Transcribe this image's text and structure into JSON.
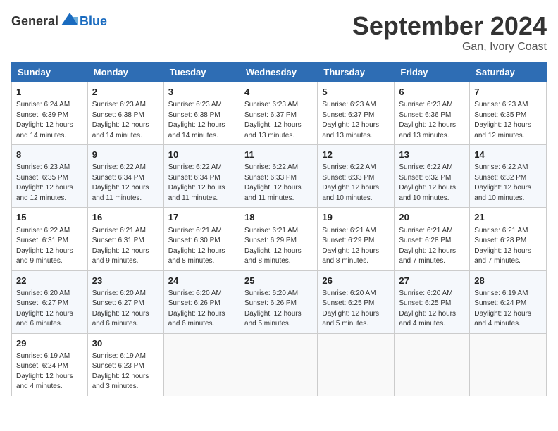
{
  "logo": {
    "text_general": "General",
    "text_blue": "Blue"
  },
  "title": "September 2024",
  "location": "Gan, Ivory Coast",
  "days_of_week": [
    "Sunday",
    "Monday",
    "Tuesday",
    "Wednesday",
    "Thursday",
    "Friday",
    "Saturday"
  ],
  "weeks": [
    [
      {
        "day": "1",
        "sunrise": "6:24 AM",
        "sunset": "6:39 PM",
        "daylight": "12 hours and 14 minutes."
      },
      {
        "day": "2",
        "sunrise": "6:23 AM",
        "sunset": "6:38 PM",
        "daylight": "12 hours and 14 minutes."
      },
      {
        "day": "3",
        "sunrise": "6:23 AM",
        "sunset": "6:38 PM",
        "daylight": "12 hours and 14 minutes."
      },
      {
        "day": "4",
        "sunrise": "6:23 AM",
        "sunset": "6:37 PM",
        "daylight": "12 hours and 13 minutes."
      },
      {
        "day": "5",
        "sunrise": "6:23 AM",
        "sunset": "6:37 PM",
        "daylight": "12 hours and 13 minutes."
      },
      {
        "day": "6",
        "sunrise": "6:23 AM",
        "sunset": "6:36 PM",
        "daylight": "12 hours and 13 minutes."
      },
      {
        "day": "7",
        "sunrise": "6:23 AM",
        "sunset": "6:35 PM",
        "daylight": "12 hours and 12 minutes."
      }
    ],
    [
      {
        "day": "8",
        "sunrise": "6:23 AM",
        "sunset": "6:35 PM",
        "daylight": "12 hours and 12 minutes."
      },
      {
        "day": "9",
        "sunrise": "6:22 AM",
        "sunset": "6:34 PM",
        "daylight": "12 hours and 11 minutes."
      },
      {
        "day": "10",
        "sunrise": "6:22 AM",
        "sunset": "6:34 PM",
        "daylight": "12 hours and 11 minutes."
      },
      {
        "day": "11",
        "sunrise": "6:22 AM",
        "sunset": "6:33 PM",
        "daylight": "12 hours and 11 minutes."
      },
      {
        "day": "12",
        "sunrise": "6:22 AM",
        "sunset": "6:33 PM",
        "daylight": "12 hours and 10 minutes."
      },
      {
        "day": "13",
        "sunrise": "6:22 AM",
        "sunset": "6:32 PM",
        "daylight": "12 hours and 10 minutes."
      },
      {
        "day": "14",
        "sunrise": "6:22 AM",
        "sunset": "6:32 PM",
        "daylight": "12 hours and 10 minutes."
      }
    ],
    [
      {
        "day": "15",
        "sunrise": "6:22 AM",
        "sunset": "6:31 PM",
        "daylight": "12 hours and 9 minutes."
      },
      {
        "day": "16",
        "sunrise": "6:21 AM",
        "sunset": "6:31 PM",
        "daylight": "12 hours and 9 minutes."
      },
      {
        "day": "17",
        "sunrise": "6:21 AM",
        "sunset": "6:30 PM",
        "daylight": "12 hours and 8 minutes."
      },
      {
        "day": "18",
        "sunrise": "6:21 AM",
        "sunset": "6:29 PM",
        "daylight": "12 hours and 8 minutes."
      },
      {
        "day": "19",
        "sunrise": "6:21 AM",
        "sunset": "6:29 PM",
        "daylight": "12 hours and 8 minutes."
      },
      {
        "day": "20",
        "sunrise": "6:21 AM",
        "sunset": "6:28 PM",
        "daylight": "12 hours and 7 minutes."
      },
      {
        "day": "21",
        "sunrise": "6:21 AM",
        "sunset": "6:28 PM",
        "daylight": "12 hours and 7 minutes."
      }
    ],
    [
      {
        "day": "22",
        "sunrise": "6:20 AM",
        "sunset": "6:27 PM",
        "daylight": "12 hours and 6 minutes."
      },
      {
        "day": "23",
        "sunrise": "6:20 AM",
        "sunset": "6:27 PM",
        "daylight": "12 hours and 6 minutes."
      },
      {
        "day": "24",
        "sunrise": "6:20 AM",
        "sunset": "6:26 PM",
        "daylight": "12 hours and 6 minutes."
      },
      {
        "day": "25",
        "sunrise": "6:20 AM",
        "sunset": "6:26 PM",
        "daylight": "12 hours and 5 minutes."
      },
      {
        "day": "26",
        "sunrise": "6:20 AM",
        "sunset": "6:25 PM",
        "daylight": "12 hours and 5 minutes."
      },
      {
        "day": "27",
        "sunrise": "6:20 AM",
        "sunset": "6:25 PM",
        "daylight": "12 hours and 4 minutes."
      },
      {
        "day": "28",
        "sunrise": "6:19 AM",
        "sunset": "6:24 PM",
        "daylight": "12 hours and 4 minutes."
      }
    ],
    [
      {
        "day": "29",
        "sunrise": "6:19 AM",
        "sunset": "6:24 PM",
        "daylight": "12 hours and 4 minutes."
      },
      {
        "day": "30",
        "sunrise": "6:19 AM",
        "sunset": "6:23 PM",
        "daylight": "12 hours and 3 minutes."
      },
      null,
      null,
      null,
      null,
      null
    ]
  ],
  "labels": {
    "sunrise": "Sunrise:",
    "sunset": "Sunset:",
    "daylight": "Daylight:"
  }
}
